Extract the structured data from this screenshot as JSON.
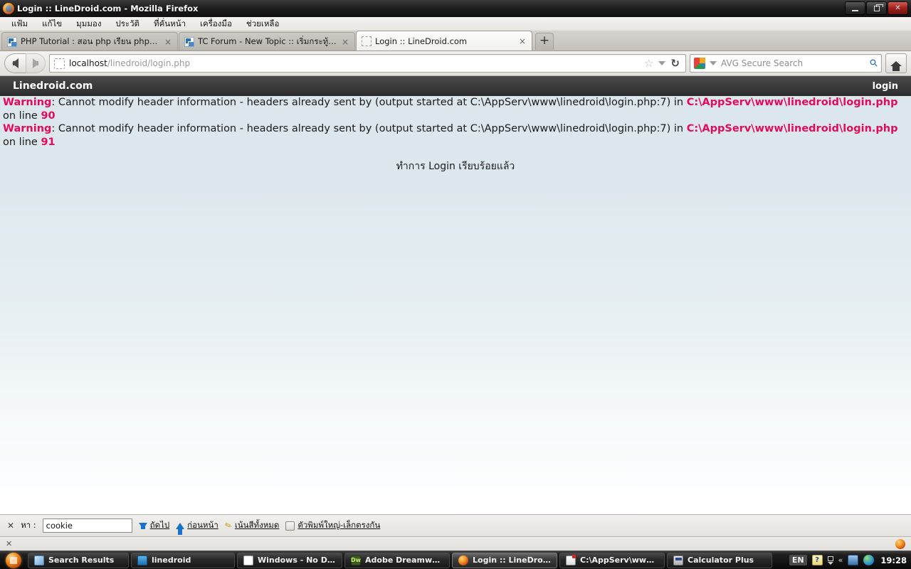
{
  "window": {
    "title": "Login :: LineDroid.com - Mozilla Firefox",
    "minimize_label": "–",
    "maximize_label": "❐",
    "close_label": "✕"
  },
  "menubar": {
    "items": [
      {
        "label": "แฟ้ม"
      },
      {
        "label": "แก้ไข"
      },
      {
        "label": "มุมมอง"
      },
      {
        "label": "ประวัติ"
      },
      {
        "label": "ที่คั่นหน้า"
      },
      {
        "label": "เครื่องมือ"
      },
      {
        "label": "ช่วยเหลือ"
      }
    ]
  },
  "tabs": {
    "items": [
      {
        "title": "PHP Tutorial : สอน php เรียน php เขียน ph...",
        "favicon": "document-icon",
        "active": false,
        "close_label": "×"
      },
      {
        "title": "TC Forum - New Topic :: เริ่มกระทู้ใหม่",
        "favicon": "document-icon",
        "active": false,
        "close_label": "×"
      },
      {
        "title": "Login :: LineDroid.com",
        "favicon": "blank-favicon-icon",
        "active": true,
        "close_label": "×"
      }
    ],
    "new_tab_label": "+"
  },
  "toolbar": {
    "back_icon": "back-arrow-icon",
    "forward_icon": "forward-arrow-icon",
    "url_host": "localhost",
    "url_path": "/linedroid/login.php",
    "url_full": "localhost/linedroid/login.php",
    "bookmark_icon": "star-icon",
    "dropdown_icon": "chevron-down-icon",
    "reload_icon": "reload-icon",
    "search_placeholder": "AVG Secure Search",
    "search_value": "",
    "search_engine_icon": "avg-logo-icon",
    "search_submit_icon": "magnifier-icon",
    "home_icon": "home-icon"
  },
  "site_header": {
    "brand": "Linedroid.com",
    "login_link": "login"
  },
  "page": {
    "warnings": [
      {
        "label": "Warning",
        "separator": ": ",
        "message": "Cannot modify header information - headers already sent by (output started at C:\\AppServ\\www\\linedroid\\login.php:7) in ",
        "path": "C:\\AppServ\\www\\linedroid\\login.php",
        "on_line_text": " on line ",
        "line": "90"
      },
      {
        "label": "Warning",
        "separator": ": ",
        "message": "Cannot modify header information - headers already sent by (output started at C:\\AppServ\\www\\linedroid\\login.php:7) in ",
        "path": "C:\\AppServ\\www\\linedroid\\login.php",
        "on_line_text": " on line ",
        "line": "91"
      }
    ],
    "success_message": "ทำการ Login เรียบร้อยแล้ว",
    "warning_color": "#e60a5d",
    "text_color": "#1b1b1b",
    "background_top_color": "#dbe7ed",
    "background_bottom_color": "#ffffff"
  },
  "findbar": {
    "close_label": "✕",
    "label": "หา :",
    "value": "cookie",
    "placeholder": "",
    "next_label": "ถัดไป",
    "previous_label": "ก่อนหน้า",
    "highlight_all_label": "เน้นสีทั้งหมด",
    "match_case_label": "ตัวพิมพ์ใหญ่-เล็กตรงกัน",
    "match_case_checked": false
  },
  "statusbar": {
    "close_label": "✕",
    "icon": "firefox-icon"
  },
  "taskbar": {
    "start_label": "start-orb-icon",
    "items": [
      {
        "label": "Search Results",
        "icon": "search-results-icon",
        "active": false
      },
      {
        "label": "linedroid",
        "icon": "folder-icon",
        "active": false
      },
      {
        "label": "Windows - No Disk",
        "icon": "window-icon",
        "active": false
      },
      {
        "label": "Adobe Dreamweave...",
        "icon": "dreamweaver-icon",
        "active": false
      },
      {
        "label": "Login :: LineDroid.co...",
        "icon": "firefox-icon",
        "active": true
      },
      {
        "label": "C:\\AppServ\\www\\li...",
        "icon": "notepad-icon",
        "active": false
      },
      {
        "label": "Calculator Plus",
        "icon": "calculator-icon",
        "active": false
      }
    ],
    "tray": {
      "language": "EN",
      "help_icon": "help-icon",
      "expand_icon": "chevron-left-icon",
      "network_icon": "network-icon",
      "globe_icon": "globe-icon",
      "clock": "19:28"
    }
  }
}
